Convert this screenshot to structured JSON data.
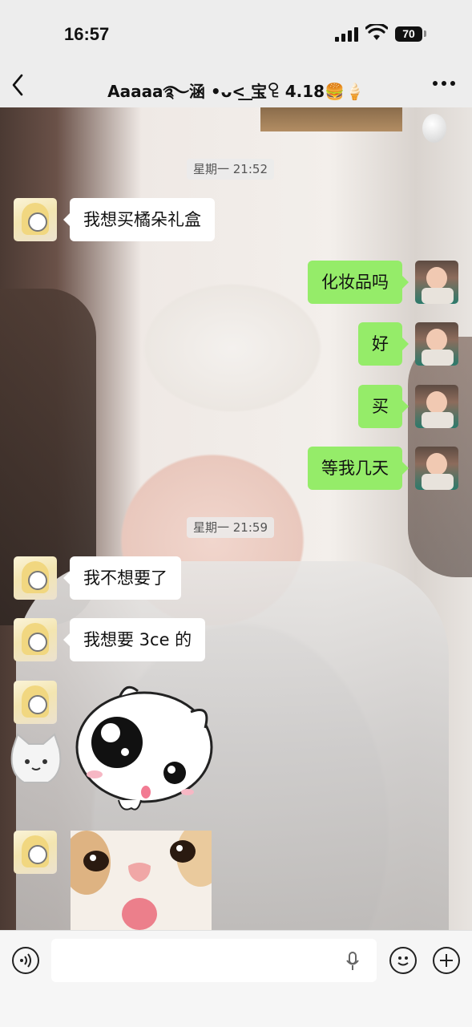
{
  "status_bar": {
    "time": "16:57",
    "battery": "70"
  },
  "header": {
    "back_icon": "chevron-left-icon",
    "title": "Aaaaa࿐涵 •ᴗ<͟ 宝ꄗ 4.18🍔🍦",
    "more_icon": "more-dots-icon"
  },
  "messages": [
    {
      "type": "timestamp",
      "text": "星期一 21:52"
    },
    {
      "type": "text",
      "side": "left",
      "text": "我想买橘朵礼盒"
    },
    {
      "type": "text",
      "side": "right",
      "text": "化妆品吗"
    },
    {
      "type": "text",
      "side": "right",
      "text": "好"
    },
    {
      "type": "text",
      "side": "right",
      "text": "买"
    },
    {
      "type": "text",
      "side": "right",
      "text": "等我几天"
    },
    {
      "type": "timestamp",
      "text": "星期一 21:59"
    },
    {
      "type": "text",
      "side": "left",
      "text": "我不想要了"
    },
    {
      "type": "text",
      "side": "left",
      "text": "我想要 3ce 的"
    },
    {
      "type": "sticker",
      "side": "left",
      "icon": "white-blob-sticker"
    },
    {
      "type": "sticker",
      "side": "left",
      "icon": "cat-photo-sticker"
    }
  ],
  "input_bar": {
    "voice_icon": "voice-wave-icon",
    "mic_icon": "microphone-icon",
    "emoji_icon": "smiley-icon",
    "plus_icon": "plus-circle-icon",
    "input_value": ""
  },
  "colors": {
    "bubble_right": "#95ec69",
    "bubble_left": "#ffffff",
    "bar_bg": "#ededed"
  }
}
